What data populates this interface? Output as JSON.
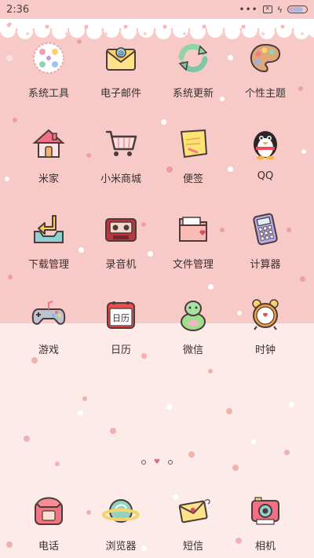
{
  "status_bar": {
    "time": "2:36",
    "signal_dots": "•••",
    "sim_label": "✕",
    "charging_icon": "ϟ",
    "battery_level": 0.85
  },
  "colors": {
    "top_bg": "#f7c9c7",
    "bottom_bg": "#fcebe8",
    "label": "#3a3030"
  },
  "apps": [
    {
      "label": "系统工具",
      "icon": "system-tools-icon"
    },
    {
      "label": "电子邮件",
      "icon": "email-envelope-icon"
    },
    {
      "label": "系统更新",
      "icon": "system-update-icon"
    },
    {
      "label": "个性主题",
      "icon": "palette-icon"
    },
    {
      "label": "米家",
      "icon": "house-icon"
    },
    {
      "label": "小米商城",
      "icon": "shopping-cart-icon"
    },
    {
      "label": "便签",
      "icon": "sticky-note-icon"
    },
    {
      "label": "QQ",
      "icon": "penguin-icon"
    },
    {
      "label": "下载管理",
      "icon": "download-tray-icon"
    },
    {
      "label": "录音机",
      "icon": "cassette-icon"
    },
    {
      "label": "文件管理",
      "icon": "folder-icon"
    },
    {
      "label": "计算器",
      "icon": "calculator-icon"
    },
    {
      "label": "游戏",
      "icon": "gamepad-icon"
    },
    {
      "label": "日历",
      "icon": "calendar-icon",
      "calendar_text": "日历"
    },
    {
      "label": "微信",
      "icon": "wechat-blob-icon"
    },
    {
      "label": "时钟",
      "icon": "alarm-clock-icon"
    }
  ],
  "page_indicator": {
    "pages": 3,
    "current": 1,
    "home_glyph": "♥"
  },
  "dock": [
    {
      "label": "电话",
      "icon": "telephone-icon"
    },
    {
      "label": "浏览器",
      "icon": "browser-planet-icon"
    },
    {
      "label": "短信",
      "icon": "message-envelope-icon"
    },
    {
      "label": "相机",
      "icon": "camera-icon"
    }
  ]
}
